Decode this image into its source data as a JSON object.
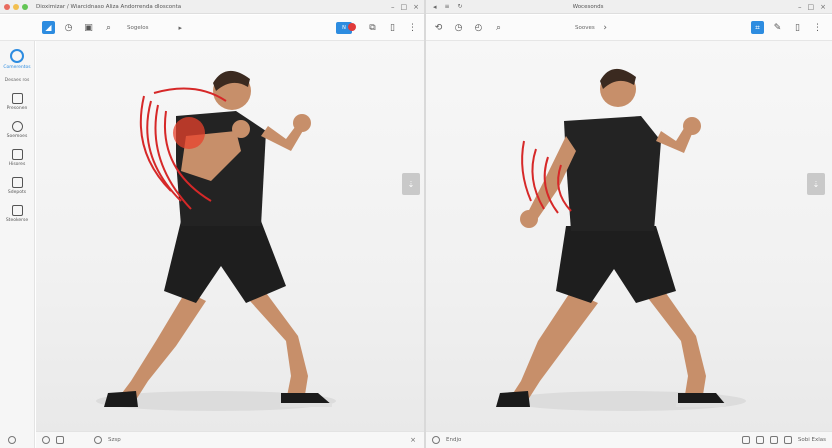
{
  "left_window": {
    "title": "Dioximizar / Wiarcidnaso Aliza Andorrenda dlosconta",
    "controls": [
      "–",
      "□",
      "×"
    ],
    "toolbar": {
      "label": "Sogelos",
      "arrow": "▸"
    }
  },
  "right_window": {
    "title": "Wocesonds",
    "controls": [
      "–",
      "□",
      "×"
    ],
    "toolbar": {
      "label": "Sooves"
    }
  },
  "sidebar": {
    "top_label": "Comerentos",
    "section_label": "Desaes ros",
    "items": [
      {
        "label": "Presonen"
      },
      {
        "label": "Soemoes"
      },
      {
        "label": "Hisores"
      },
      {
        "label": "Sdepots"
      },
      {
        "label": "Steokerse"
      }
    ]
  },
  "status_left": {
    "text": "Szsp"
  },
  "status_right": {
    "text": "Endjo",
    "readout": "Sobi Exlas"
  },
  "colors": {
    "accent": "#2d8ce0",
    "close": "#e86b5f",
    "minimize": "#f2bf4f",
    "maximize": "#62c554",
    "notification": "#e03a3a",
    "motion_lines": "#d62828"
  }
}
